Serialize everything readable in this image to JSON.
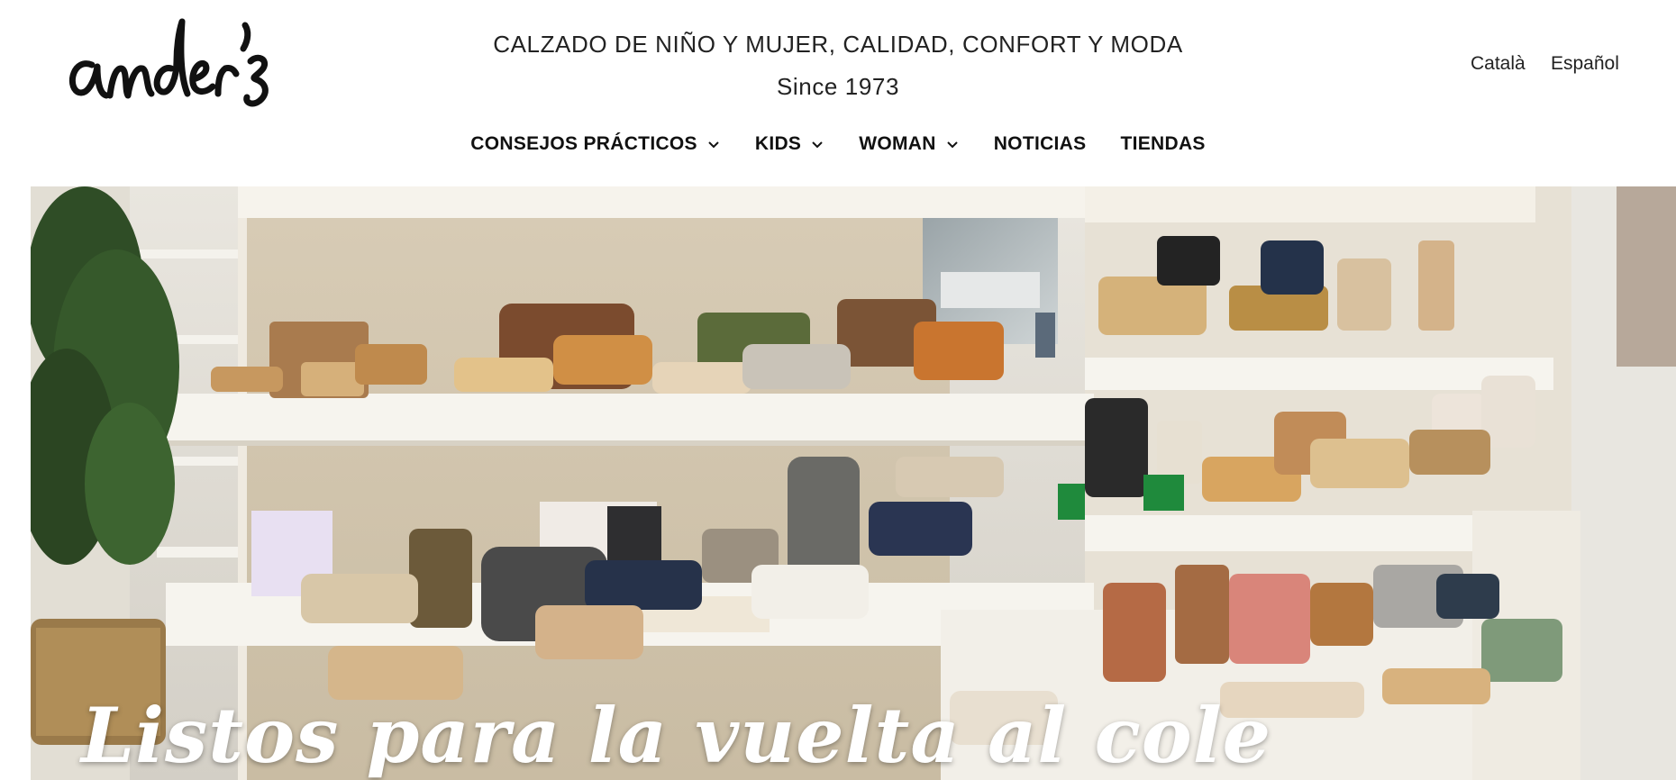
{
  "brand": {
    "logo_text": "ander's"
  },
  "header": {
    "tagline": "CALZADO DE NIÑO Y MUJER, CALIDAD, CONFORT Y MODA",
    "since": "Since 1973"
  },
  "languages": [
    "Català",
    "Español"
  ],
  "nav": [
    {
      "label": "CONSEJOS PRÁCTICOS",
      "dropdown": true
    },
    {
      "label": "KIDS",
      "dropdown": true
    },
    {
      "label": "WOMAN",
      "dropdown": true
    },
    {
      "label": "NOTICIAS",
      "dropdown": false
    },
    {
      "label": "TIENDAS",
      "dropdown": false
    }
  ],
  "hero": {
    "title": "Listos para la vuelta al cole",
    "image_subject": "shoe store shelves with sandals, espadrilles and bags"
  },
  "icons": {
    "dropdown": "chevron-down-icon"
  }
}
